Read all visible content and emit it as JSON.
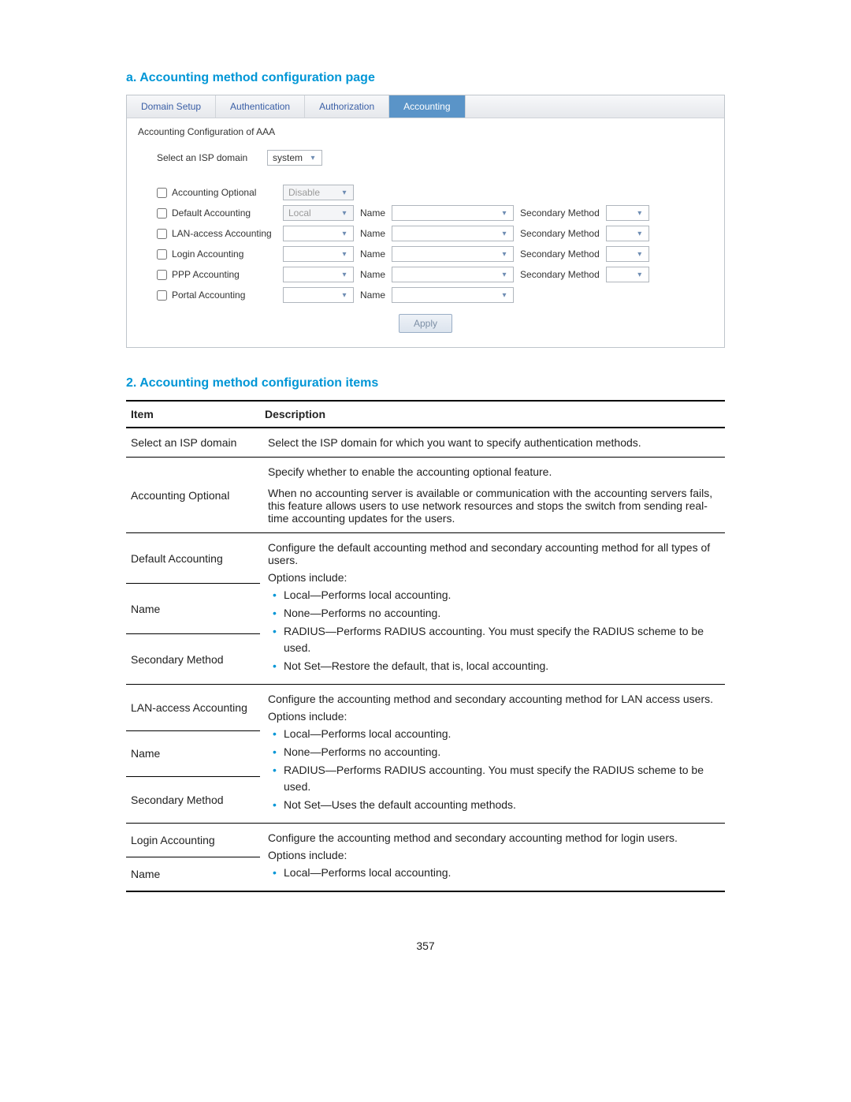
{
  "heading_a": "a.    Accounting method configuration page",
  "tabs": {
    "domain": "Domain Setup",
    "auth": "Authentication",
    "authz": "Authorization",
    "acct": "Accounting"
  },
  "panel": {
    "title": "Accounting Configuration of AAA",
    "select_domain_label": "Select an ISP domain",
    "domain_value": "system",
    "rows": {
      "r1": "Accounting Optional",
      "r2": "Default Accounting",
      "r3": "LAN-access Accounting",
      "r4": "Login Accounting",
      "r5": "PPP Accounting",
      "r6": "Portal Accounting"
    },
    "method_disable": "Disable",
    "method_local": "Local",
    "name_label": "Name",
    "secondary_label": "Secondary Method",
    "apply": "Apply"
  },
  "heading_2": "2.    Accounting method configuration items",
  "table": {
    "h1": "Item",
    "h2": "Description",
    "r1_item": "Select an ISP domain",
    "r1_desc": "Select the ISP domain for which you want to specify authentication methods.",
    "r2_item": "Accounting Optional",
    "r2_p1": "Specify whether to enable the accounting optional feature.",
    "r2_p2": "When no accounting server is available or communication with the accounting servers fails, this feature allows users to use network resources and stops the switch from sending real-time accounting updates for the users.",
    "r3_item": "Default Accounting",
    "r3_desc": "Configure the default accounting method and secondary accounting method for all types of users.",
    "r4_item": "Name",
    "r4_opts": "Options include:",
    "r4_b1": "Local—Performs local accounting.",
    "r5_item": "Secondary Method",
    "r5_b1": "None—Performs no accounting.",
    "r5_b2": "RADIUS—Performs RADIUS accounting. You must specify the RADIUS scheme to be used.",
    "r5_b3": "Not Set—Restore the default, that is, local accounting.",
    "r6_item": "LAN-access Accounting",
    "r6_desc": "Configure the accounting method and secondary accounting method for LAN access users.",
    "r7_item": "Name",
    "r7_opts": "Options include:",
    "r7_b1": "Local—Performs local accounting.",
    "r8_item": "Secondary Method",
    "r8_b1": "None—Performs no accounting.",
    "r8_b2": "RADIUS—Performs RADIUS accounting. You must specify the RADIUS scheme to be used.",
    "r8_b3": "Not Set—Uses the default accounting methods.",
    "r9_item": "Login Accounting",
    "r9_desc": "Configure the accounting method and secondary accounting method for login users.",
    "r10_item": "Name",
    "r10_opts": "Options include:",
    "r10_b1": "Local—Performs local accounting."
  },
  "page_number": "357"
}
